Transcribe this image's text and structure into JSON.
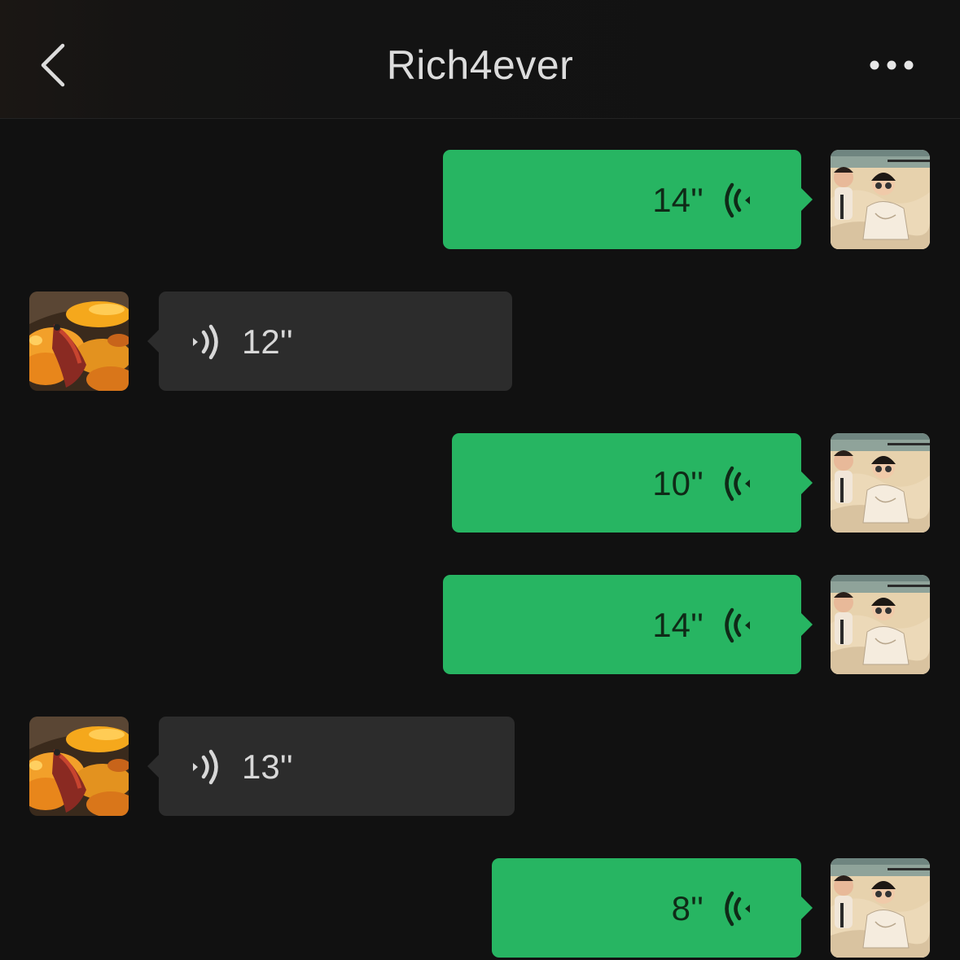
{
  "header": {
    "title": "Rich4ever",
    "back_icon": "chevron-left-icon",
    "more_icon": "more-horizontal-icon"
  },
  "colors": {
    "background": "#111111",
    "sent_bubble": "#27b562",
    "received_bubble": "#2c2c2c",
    "title_text": "#dcdcdc"
  },
  "messages": [
    {
      "direction": "sent",
      "duration": "14''"
    },
    {
      "direction": "received",
      "duration": "12''"
    },
    {
      "direction": "sent",
      "duration": "10''"
    },
    {
      "direction": "sent",
      "duration": "14''"
    },
    {
      "direction": "received",
      "duration": "13''"
    },
    {
      "direction": "sent",
      "duration": "8''"
    }
  ]
}
